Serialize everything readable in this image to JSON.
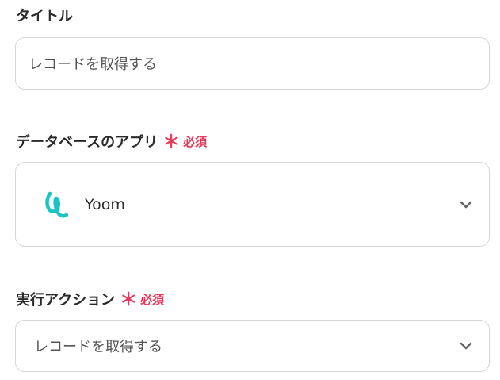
{
  "title_section": {
    "label": "タイトル",
    "value": "レコードを取得する"
  },
  "app_section": {
    "label": "データベースのアプリ",
    "required_mark": "＊",
    "required_text": "必須",
    "selected_app": "Yoom",
    "app_icon": "yoom-logo-icon",
    "chevron_icon": "chevron-down-icon"
  },
  "action_section": {
    "label": "実行アクション",
    "required_mark": "＊",
    "required_text": "必須",
    "selected_action": "レコードを取得する",
    "chevron_icon": "chevron-down-icon"
  },
  "colors": {
    "required": "#e8385a",
    "logo_teal": "#1cc3c3",
    "border": "#d6d6d6"
  }
}
